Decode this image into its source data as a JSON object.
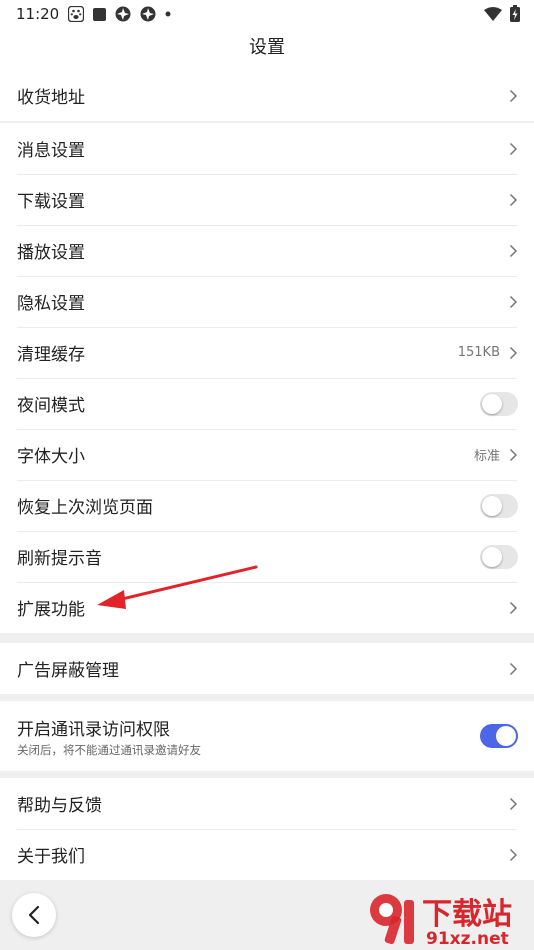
{
  "status_bar": {
    "time": "11:20"
  },
  "header": {
    "title": "设置"
  },
  "groups": [
    {
      "items": [
        {
          "label": "收货地址"
        }
      ]
    },
    {
      "items": [
        {
          "label": "消息设置"
        },
        {
          "label": "下载设置"
        },
        {
          "label": "播放设置"
        },
        {
          "label": "隐私设置"
        },
        {
          "label": "清理缓存",
          "value": "151KB"
        },
        {
          "label": "夜间模式",
          "toggle": false
        },
        {
          "label": "字体大小",
          "value": "标准"
        },
        {
          "label": "恢复上次浏览页面",
          "toggle": false
        },
        {
          "label": "刷新提示音",
          "toggle": false
        },
        {
          "label": "扩展功能"
        }
      ]
    },
    {
      "items": [
        {
          "label": "广告屏蔽管理"
        }
      ]
    },
    {
      "items": [
        {
          "label": "开启通讯录访问权限",
          "sub": "关闭后，将不能通过通讯录邀请好友",
          "toggle": true
        }
      ]
    },
    {
      "items": [
        {
          "label": "帮助与反馈"
        },
        {
          "label": "关于我们"
        }
      ]
    }
  ],
  "watermark": {
    "text_top": "下载站",
    "text_bottom": "91xz.net"
  },
  "colors": {
    "toggle_on": "#4b66e6",
    "annotation_arrow": "#e0242a",
    "watermark": "#d8262c"
  }
}
